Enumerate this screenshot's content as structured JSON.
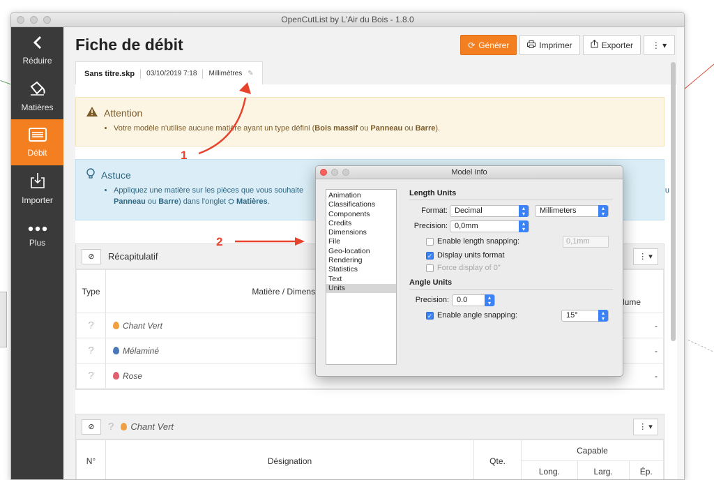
{
  "window": {
    "title": "OpenCutList by L'Air du Bois - 1.8.0"
  },
  "sidebar": {
    "items": [
      {
        "label": "Réduire",
        "icon": "chevron-left-icon"
      },
      {
        "label": "Matières",
        "icon": "paint-bucket-icon"
      },
      {
        "label": "Débit",
        "icon": "list-icon",
        "active": true
      },
      {
        "label": "Importer",
        "icon": "import-icon"
      },
      {
        "label": "Plus",
        "icon": "more-dots-icon"
      }
    ]
  },
  "page": {
    "title": "Fiche de débit"
  },
  "toolbar": {
    "generate_label": "Générer",
    "print_label": "Imprimer",
    "export_label": "Exporter",
    "accent_color": "#f47f20"
  },
  "file_tab": {
    "filename": "Sans titre.skp",
    "date": "03/10/2019 7:18",
    "unit": "Millimètres"
  },
  "alerts": {
    "warning": {
      "title": "Attention",
      "text_pre": "Votre modèle n'utilise aucune matière ayant un type défini (",
      "b1": "Bois massif",
      "mid1": " ou ",
      "b2": "Panneau",
      "mid2": " ou ",
      "b3": "Barre",
      "text_post": ")."
    },
    "tip": {
      "title": "Astuce",
      "line1": "Appliquez une matière sur les pièces que vous souhaite",
      "line1_tail": "u",
      "b1": "Panneau",
      "mid": " ou ",
      "b2": "Barre",
      "line2_post": ") dans l'onglet ",
      "tab_name": "Matières",
      "end": "."
    }
  },
  "summary": {
    "title": "Récapitulatif",
    "columns": {
      "type": "Type",
      "material": "Matière / Dimension",
      "volume": "olume"
    },
    "rows": [
      {
        "type": "?",
        "material": "Chant Vert",
        "color": "#f0a040",
        "volume": "-"
      },
      {
        "type": "?",
        "material": "Mélaminé",
        "color": "#4a78b8",
        "volume": "-"
      },
      {
        "type": "?",
        "material": "Rose",
        "color": "#e06070",
        "volume": "-"
      }
    ]
  },
  "group": {
    "type": "?",
    "title": "Chant Vert",
    "color": "#f0a040",
    "columns": {
      "num": "N°",
      "designation": "Désignation",
      "qty": "Qte.",
      "capable": "Capable",
      "long": "Long.",
      "larg": "Larg.",
      "ep": "Ép."
    }
  },
  "annotations": {
    "label1": "1",
    "label2": "2",
    "color": "#e8432d"
  },
  "dialog": {
    "title": "Model Info",
    "list": [
      "Animation",
      "Classifications",
      "Components",
      "Credits",
      "Dimensions",
      "File",
      "Geo-location",
      "Rendering",
      "Statistics",
      "Text",
      "Units"
    ],
    "selected": "Units",
    "length": {
      "section": "Length Units",
      "format_label": "Format:",
      "format_value": "Decimal",
      "unit_value": "Millimeters",
      "precision_label": "Precision:",
      "precision_value": "0,0mm",
      "snap_label": "Enable length snapping:",
      "snap_checked": false,
      "snap_value": "0,1mm",
      "display_label": "Display units format",
      "display_checked": true,
      "force_label": "Force display of 0\""
    },
    "angle": {
      "section": "Angle Units",
      "precision_label": "Precision:",
      "precision_value": "0.0",
      "snap_label": "Enable angle snapping:",
      "snap_checked": true,
      "snap_value": "15°"
    }
  }
}
